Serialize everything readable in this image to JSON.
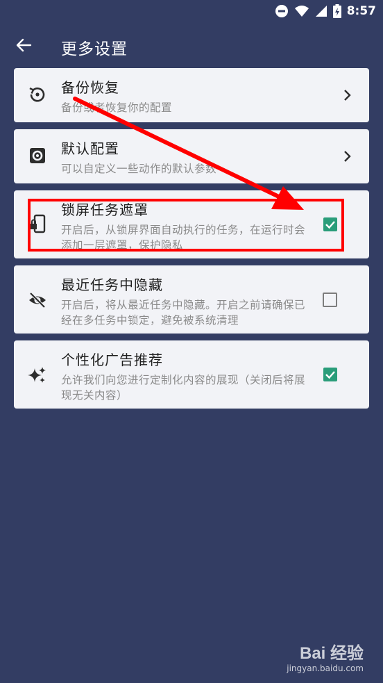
{
  "status_bar": {
    "time": "8:57",
    "icons": [
      "dnd-icon",
      "wifi-icon",
      "signal-icon",
      "battery-charging-icon"
    ]
  },
  "app_bar": {
    "title": "更多设置",
    "back_icon": "arrow-left-icon"
  },
  "items": [
    {
      "title": "备份恢复",
      "subtitle": "备份或者恢复你的配置",
      "icon": "restore-icon",
      "control": "chevron"
    },
    {
      "title": "默认配置",
      "subtitle": "可以自定义一些动作的默认参数",
      "icon": "gear-icon",
      "control": "chevron"
    },
    {
      "title": "锁屏任务遮罩",
      "subtitle": "开启后，从锁屏界面自动执行的任务，在运行时会添加一层遮罩，保护隐私",
      "icon": "phone-lock-icon",
      "control": "checkbox",
      "checked": true
    },
    {
      "title": "最近任务中隐藏",
      "subtitle": "开启后，将从最近任务中隐藏。开启之前请确保已经在多任务中锁定，避免被系统清理",
      "icon": "eye-off-icon",
      "control": "checkbox",
      "checked": false
    },
    {
      "title": "个性化广告推荐",
      "subtitle": "允许我们向您进行定制化内容的展现（关闭后将展现无关内容）",
      "icon": "sparkle-icon",
      "control": "checkbox",
      "checked": true
    }
  ],
  "watermark": {
    "logo": "Bai 经验",
    "url": "jingyan.baidu.com"
  },
  "colors": {
    "background": "#333d63",
    "card": "#f2f3f7",
    "checkbox_on": "#2a9d7a",
    "annotation": "#ff0000"
  }
}
